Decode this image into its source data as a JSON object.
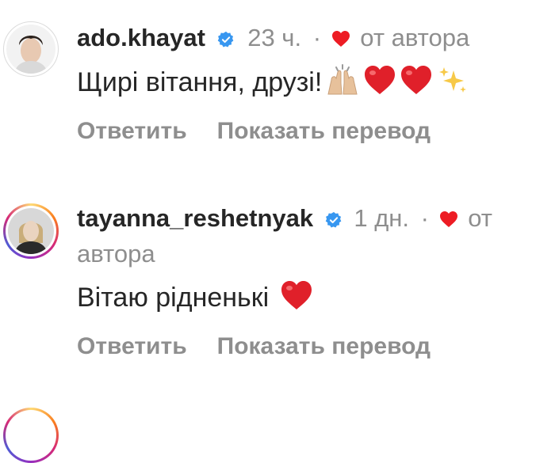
{
  "comments": [
    {
      "username": "ado.khayat",
      "time": "23 ч.",
      "separator": "·",
      "author_like_label": "от автора",
      "text": "Щирі вітання, друзі!",
      "reply_label": "Ответить",
      "translate_label": "Показать перевод"
    },
    {
      "username": "tayanna_reshetnyak",
      "time": "1 дн.",
      "separator": "·",
      "author_like_label_part1": "от",
      "author_like_label_part2": "автора",
      "text": "Вітаю рідненькі",
      "reply_label": "Ответить",
      "translate_label": "Показать перевод"
    }
  ],
  "icons": {
    "verified": "verified-badge-icon",
    "heart": "red-heart-icon",
    "hands": "raising-hands-icon",
    "sparkles": "sparkles-icon"
  },
  "colors": {
    "verified_blue": "#3897f0",
    "heart_red": "#ed4956",
    "meta_gray": "#8e8e8e",
    "text_dark": "#262626"
  }
}
